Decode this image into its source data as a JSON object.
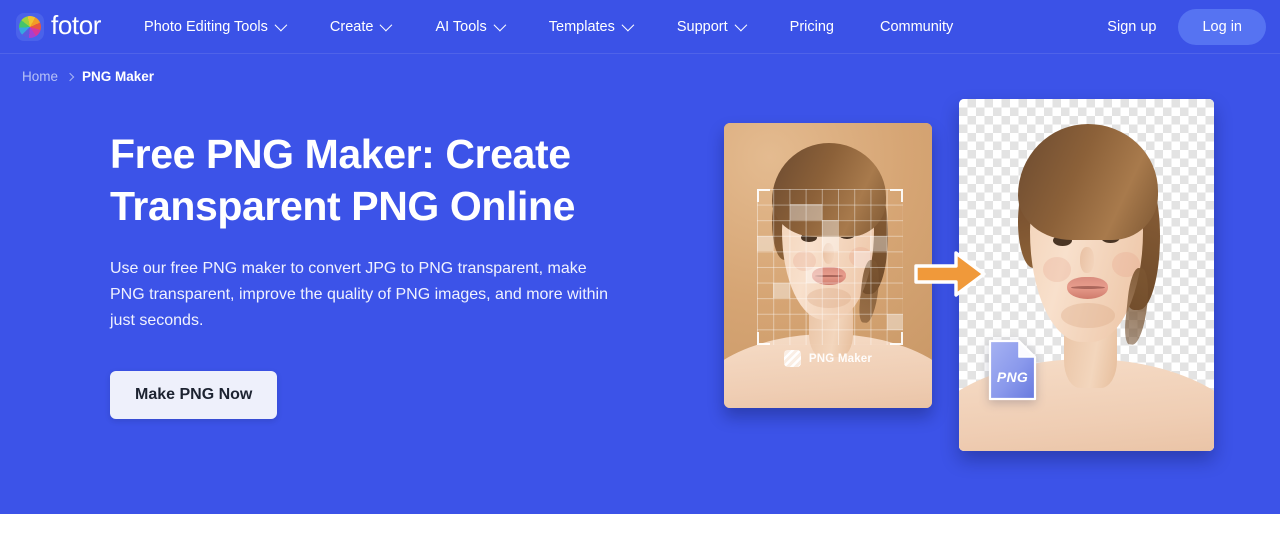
{
  "brand": {
    "logo_icon": "fotor-color-wheel-logo-icon",
    "name": "fotor"
  },
  "colors": {
    "header_bg": "#3b52e7",
    "hero_bg": "#3c53e8",
    "login_pill": "#5673f2",
    "cta_bg": "#eef0fb",
    "cta_text": "#1d2331",
    "breadcrumb_muted": "#b7c2f6",
    "arrow_orange": "#f0993a",
    "png_badge_from": "#9aa8ef",
    "png_badge_to": "#6b7fe0",
    "before_card_bg": "#d6a574"
  },
  "header": {
    "nav": [
      {
        "label": "Photo Editing Tools",
        "has_dropdown": true,
        "icon": "chevron-down-icon"
      },
      {
        "label": "Create",
        "has_dropdown": true,
        "icon": "chevron-down-icon"
      },
      {
        "label": "AI Tools",
        "has_dropdown": true,
        "icon": "chevron-down-icon"
      },
      {
        "label": "Templates",
        "has_dropdown": true,
        "icon": "chevron-down-icon"
      },
      {
        "label": "Support",
        "has_dropdown": true,
        "icon": "chevron-down-icon"
      },
      {
        "label": "Pricing",
        "has_dropdown": false,
        "icon": ""
      },
      {
        "label": "Community",
        "has_dropdown": false,
        "icon": ""
      }
    ],
    "signup_label": "Sign up",
    "login_label": "Log in"
  },
  "breadcrumb": {
    "home_label": "Home",
    "separator_icon": "chevron-right-icon",
    "current_label": "PNG Maker"
  },
  "hero": {
    "title": "Free PNG Maker: Create Transparent PNG Online",
    "subtitle": "Use our free PNG maker to convert JPG to PNG transparent, make PNG transparent, improve the quality of PNG images, and more within just seconds.",
    "cta_label": "Make PNG Now"
  },
  "visual": {
    "before": {
      "watermark_label": "PNG Maker",
      "watermark_icon": "diagonal-stripes-icon",
      "overlay": "selection-grid-with-corner-brackets"
    },
    "arrow_icon": "right-arrow-icon",
    "after": {
      "background": "transparency-checkerboard",
      "badge_label": "PNG",
      "badge_icon": "png-file-icon"
    }
  }
}
